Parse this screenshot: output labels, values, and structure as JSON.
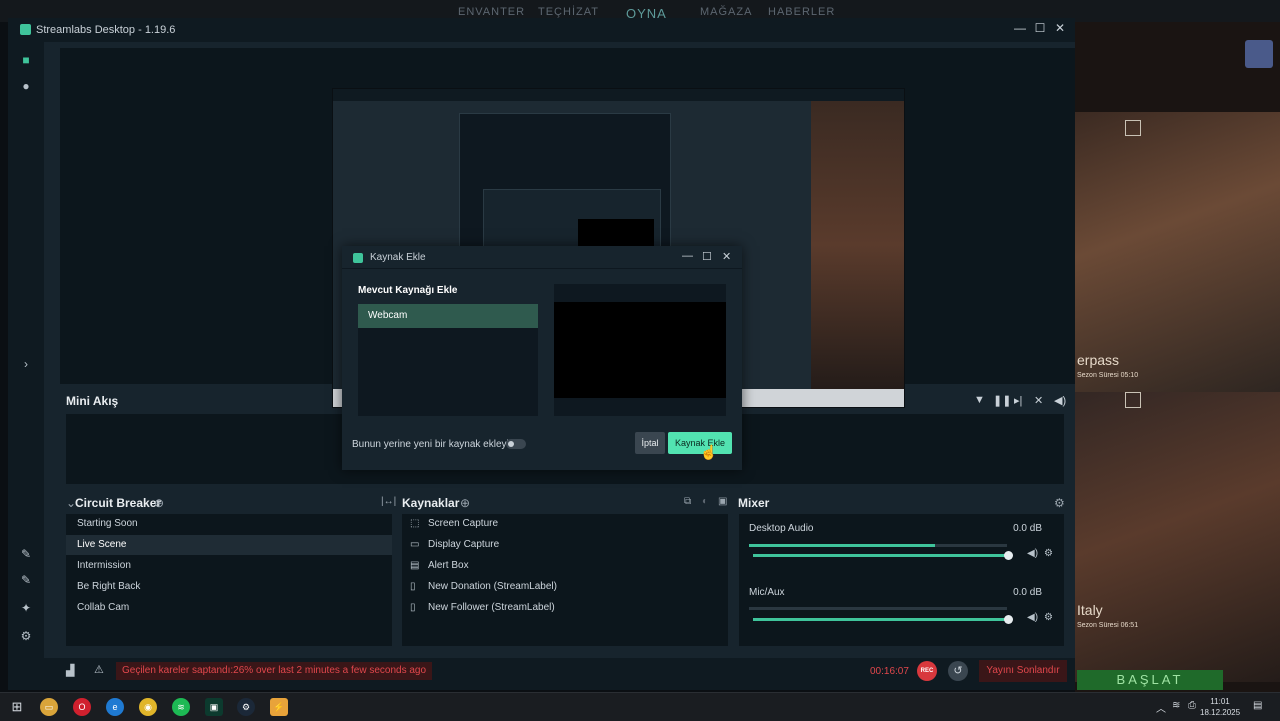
{
  "game_nav": [
    "ENVANTER",
    "TEÇHİZAT",
    "OYNA",
    "MAĞAZA",
    "HABERLER"
  ],
  "background": {
    "text1": "erpass",
    "text2": "Sezon Süresi 05:10",
    "text3": "Italy",
    "text4": "Sezon Süresi 06:51",
    "banner": "BAŞLAT"
  },
  "window": {
    "title": "Streamlabs Desktop - 1.19.6"
  },
  "mini": {
    "title": "Mini Akış"
  },
  "scenes": {
    "title": "Circuit Breaker",
    "items": [
      "Starting Soon",
      "Live Scene",
      "Intermission",
      "Be Right Back",
      "Collab Cam"
    ],
    "active": "Live Scene"
  },
  "sources": {
    "title": "Kaynaklar",
    "items": [
      {
        "label": "Screen Capture",
        "icon": "screen-capture-icon"
      },
      {
        "label": "Display Capture",
        "icon": "monitor-icon"
      },
      {
        "label": "Alert Box",
        "icon": "alert-box-icon"
      },
      {
        "label": "New Donation (StreamLabel)",
        "icon": "file-icon"
      },
      {
        "label": "New Follower (StreamLabel)",
        "icon": "file-icon"
      }
    ]
  },
  "mixer": {
    "title": "Mixer",
    "channels": [
      {
        "name": "Desktop Audio",
        "db": "0.0 dB",
        "level": 0.72,
        "volume": 1.0
      },
      {
        "name": "Mic/Aux",
        "db": "0.0 dB",
        "level": 0.0,
        "volume": 1.0
      }
    ]
  },
  "status": {
    "warning": "Geçilen kareler saptandı:26% over last 2 minutes a few seconds ago",
    "timer": "00:16:07",
    "rec": "REC",
    "end_stream": "Yayını Sonlandır"
  },
  "dialog": {
    "title": "Kaynak Ekle",
    "heading": "Mevcut Kaynağı Ekle",
    "item": "Webcam",
    "toggle_label": "Bunun yerine yeni bir kaynak ekleyin",
    "cancel": "İptal",
    "add": "Kaynak Ekle"
  },
  "taskbar": {
    "time": "11:01",
    "date": "18.12.2025"
  }
}
